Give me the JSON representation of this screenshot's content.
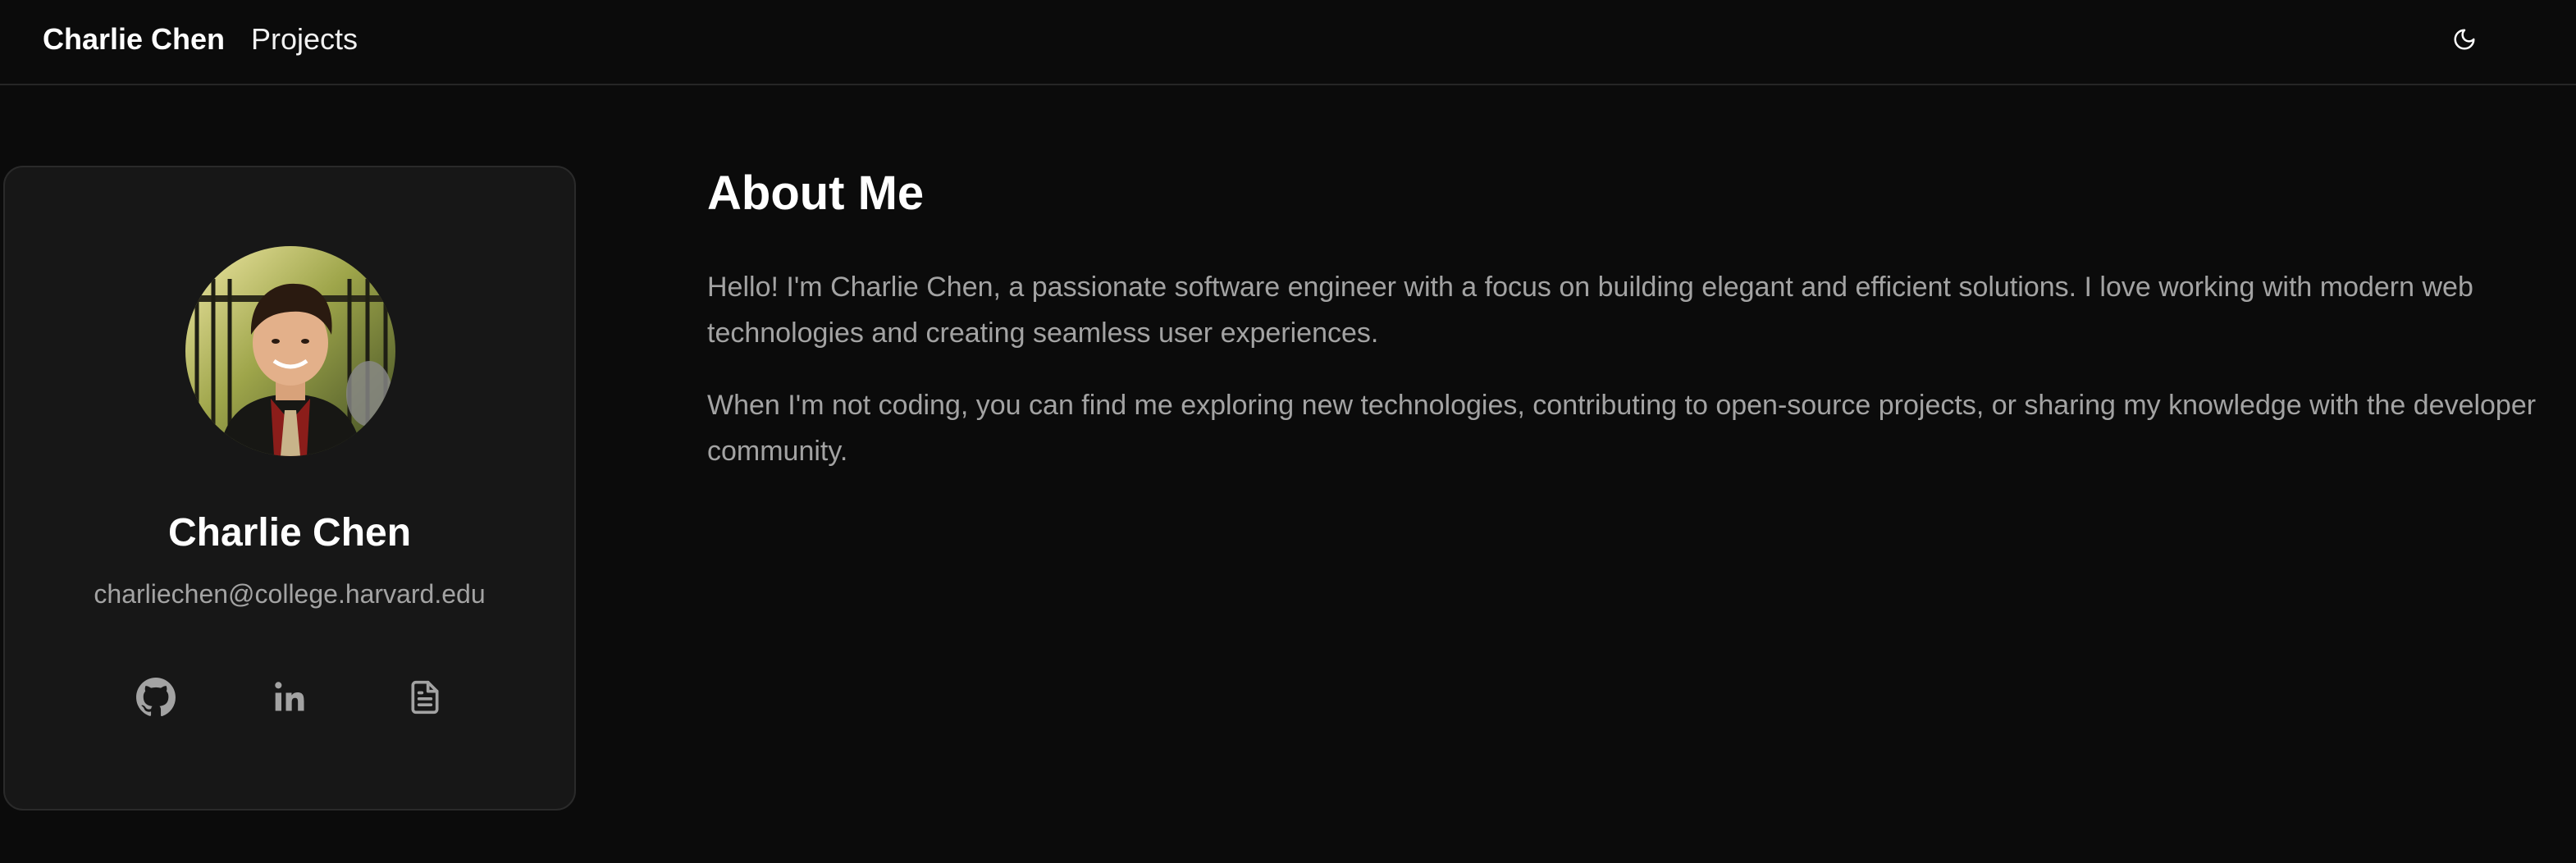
{
  "nav": {
    "brand": "Charlie Chen",
    "links": [
      {
        "label": "Projects"
      }
    ],
    "theme_toggle_icon": "moon-icon"
  },
  "profile": {
    "name": "Charlie Chen",
    "email": "charliechen@college.harvard.edu",
    "avatar_icon": "avatar",
    "social": [
      {
        "icon": "github-icon"
      },
      {
        "icon": "linkedin-icon"
      },
      {
        "icon": "document-icon"
      }
    ]
  },
  "about": {
    "title": "About Me",
    "paragraphs": [
      "Hello! I'm Charlie Chen, a passionate software engineer with a focus on building elegant and efficient solutions. I love working with modern web technologies and creating seamless user experiences.",
      "When I'm not coding, you can find me exploring new technologies, contributing to open-source projects, or sharing my knowledge with the developer community."
    ]
  },
  "colors": {
    "background": "#0b0b0b",
    "card": "#171717",
    "text_primary": "#ffffff",
    "text_muted": "#a3a3a3",
    "border": "#262626"
  }
}
